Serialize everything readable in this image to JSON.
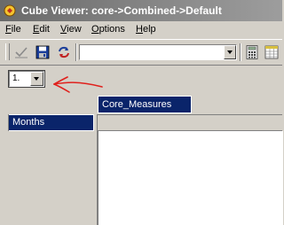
{
  "window": {
    "title": "Cube Viewer: core->Combined->Default"
  },
  "menu": {
    "items": [
      {
        "key": "F",
        "rest": "ile"
      },
      {
        "key": "E",
        "rest": "dit"
      },
      {
        "key": "V",
        "rest": "iew"
      },
      {
        "key": "O",
        "rest": "ptions"
      },
      {
        "key": "H",
        "rest": "elp"
      }
    ]
  },
  "toolbar": {
    "view_combo_value": "",
    "buttons": [
      "check-icon",
      "save-icon",
      "recalculate-icon",
      "calculator-icon",
      "spreadsheet-icon"
    ]
  },
  "title_dimension": {
    "selected": "1."
  },
  "grid": {
    "column_header": "Core_Measures",
    "row_header": "Months"
  },
  "colors": {
    "header_bg": "#0a246a",
    "annotation_arrow": "#e0201c",
    "titlebar": "#7a7a7a"
  }
}
